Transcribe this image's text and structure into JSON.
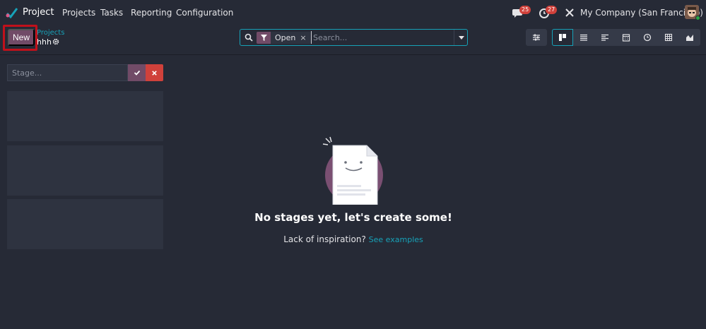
{
  "navbar": {
    "app_name": "Project",
    "menu": [
      "Projects",
      "Tasks",
      "Reporting",
      "Configuration"
    ],
    "messages_count": "25",
    "activities_count": "27",
    "company": "My Company (San Francisco)"
  },
  "control_panel": {
    "new_label": "New",
    "breadcrumb": "Projects",
    "record_name": "hhh",
    "search": {
      "facet_label": "Open",
      "facet_remove": "×",
      "placeholder": "Search..."
    }
  },
  "kanban": {
    "stage_placeholder": "Stage..."
  },
  "helper": {
    "title": "No stages yet, let's create some!",
    "subtitle": "Lack of inspiration?",
    "link": "See examples"
  },
  "colors": {
    "background": "#262a36",
    "brand": "#714b67",
    "accent": "#17a2b8",
    "danger": "#d0413b"
  }
}
